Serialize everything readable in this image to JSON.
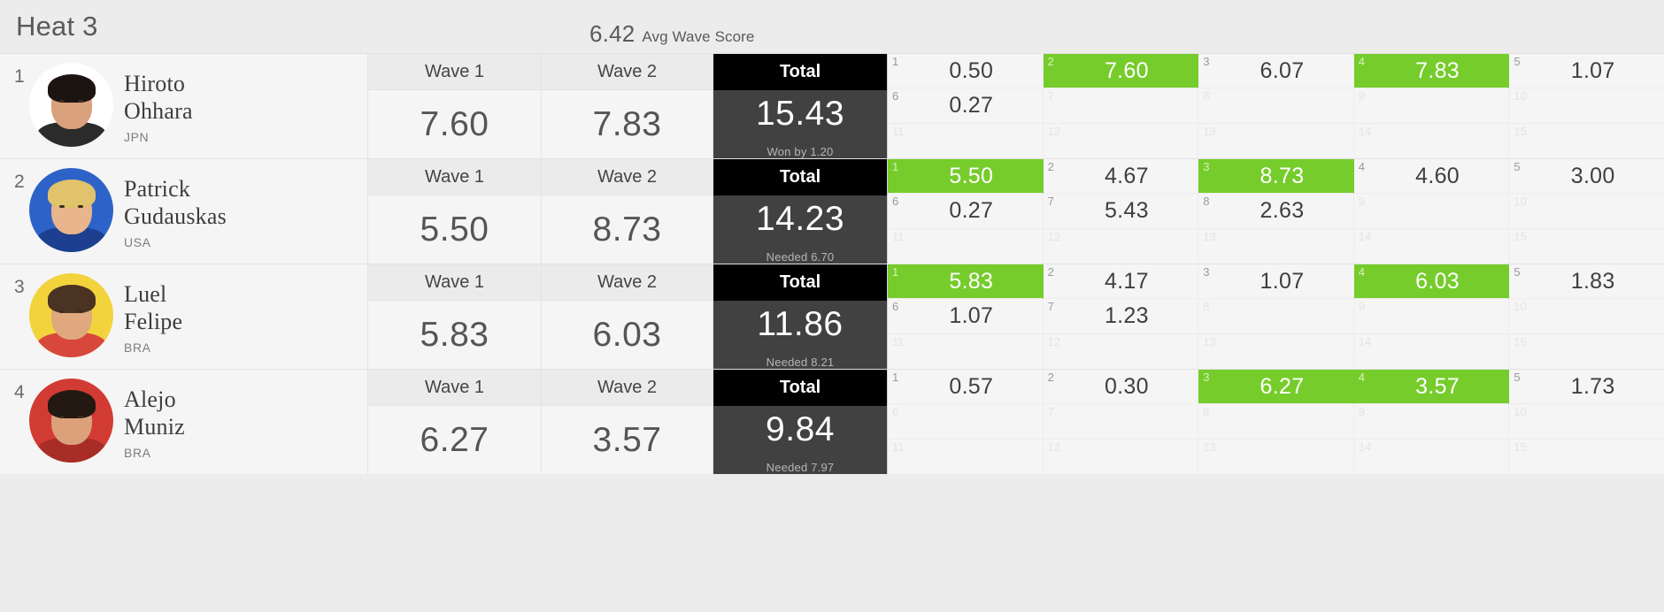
{
  "header": {
    "heat_title": "Heat 3",
    "avg_value": "6.42",
    "avg_label": "Avg Wave Score"
  },
  "columns": {
    "wave1": "Wave 1",
    "wave2": "Wave 2",
    "total": "Total"
  },
  "colors": {
    "highlight_green": "#76cc2b",
    "total_header_bg": "#000000",
    "total_body_bg": "#414141",
    "page_bg": "#ececec",
    "row_bg": "#f5f5f5"
  },
  "surfers": [
    {
      "rank": "1",
      "first_name": "Hiroto",
      "last_name": "Ohhara",
      "country": "JPN",
      "wave1": "7.60",
      "wave2": "7.83",
      "total": "15.43",
      "note": "Won by 1.20",
      "avatar": {
        "bg": "#ffffff",
        "skin": "#d9a07c",
        "hair": "#1c1411",
        "shirt": "#2b2b2b"
      },
      "waves": [
        {
          "idx": "1",
          "value": "0.50",
          "counting": false
        },
        {
          "idx": "2",
          "value": "7.60",
          "counting": true
        },
        {
          "idx": "3",
          "value": "6.07",
          "counting": false
        },
        {
          "idx": "4",
          "value": "7.83",
          "counting": true
        },
        {
          "idx": "5",
          "value": "1.07",
          "counting": false
        },
        {
          "idx": "6",
          "value": "0.27",
          "counting": false
        },
        {
          "idx": "7",
          "value": "",
          "counting": false
        },
        {
          "idx": "8",
          "value": "",
          "counting": false
        },
        {
          "idx": "9",
          "value": "",
          "counting": false
        },
        {
          "idx": "10",
          "value": "",
          "counting": false
        },
        {
          "idx": "11",
          "value": "",
          "counting": false
        },
        {
          "idx": "12",
          "value": "",
          "counting": false
        },
        {
          "idx": "13",
          "value": "",
          "counting": false
        },
        {
          "idx": "14",
          "value": "",
          "counting": false
        },
        {
          "idx": "15",
          "value": "",
          "counting": false
        }
      ]
    },
    {
      "rank": "2",
      "first_name": "Patrick",
      "last_name": "Gudauskas",
      "country": "USA",
      "wave1": "5.50",
      "wave2": "8.73",
      "total": "14.23",
      "note": "Needed 6.70",
      "avatar": {
        "bg": "#2d63c8",
        "skin": "#e8b58c",
        "hair": "#e0c36a",
        "shirt": "#1c3f8f"
      },
      "waves": [
        {
          "idx": "1",
          "value": "5.50",
          "counting": true
        },
        {
          "idx": "2",
          "value": "4.67",
          "counting": false
        },
        {
          "idx": "3",
          "value": "8.73",
          "counting": true
        },
        {
          "idx": "4",
          "value": "4.60",
          "counting": false
        },
        {
          "idx": "5",
          "value": "3.00",
          "counting": false
        },
        {
          "idx": "6",
          "value": "0.27",
          "counting": false
        },
        {
          "idx": "7",
          "value": "5.43",
          "counting": false
        },
        {
          "idx": "8",
          "value": "2.63",
          "counting": false
        },
        {
          "idx": "9",
          "value": "",
          "counting": false
        },
        {
          "idx": "10",
          "value": "",
          "counting": false
        },
        {
          "idx": "11",
          "value": "",
          "counting": false
        },
        {
          "idx": "12",
          "value": "",
          "counting": false
        },
        {
          "idx": "13",
          "value": "",
          "counting": false
        },
        {
          "idx": "14",
          "value": "",
          "counting": false
        },
        {
          "idx": "15",
          "value": "",
          "counting": false
        }
      ]
    },
    {
      "rank": "3",
      "first_name": "Luel",
      "last_name": "Felipe",
      "country": "BRA",
      "wave1": "5.83",
      "wave2": "6.03",
      "total": "11.86",
      "note": "Needed 8.21",
      "avatar": {
        "bg": "#f2d33c",
        "skin": "#e0a87e",
        "hair": "#4a3322",
        "shirt": "#d8473c"
      },
      "waves": [
        {
          "idx": "1",
          "value": "5.83",
          "counting": true
        },
        {
          "idx": "2",
          "value": "4.17",
          "counting": false
        },
        {
          "idx": "3",
          "value": "1.07",
          "counting": false
        },
        {
          "idx": "4",
          "value": "6.03",
          "counting": true
        },
        {
          "idx": "5",
          "value": "1.83",
          "counting": false
        },
        {
          "idx": "6",
          "value": "1.07",
          "counting": false
        },
        {
          "idx": "7",
          "value": "1.23",
          "counting": false
        },
        {
          "idx": "8",
          "value": "",
          "counting": false
        },
        {
          "idx": "9",
          "value": "",
          "counting": false
        },
        {
          "idx": "10",
          "value": "",
          "counting": false
        },
        {
          "idx": "11",
          "value": "",
          "counting": false
        },
        {
          "idx": "12",
          "value": "",
          "counting": false
        },
        {
          "idx": "13",
          "value": "",
          "counting": false
        },
        {
          "idx": "14",
          "value": "",
          "counting": false
        },
        {
          "idx": "15",
          "value": "",
          "counting": false
        }
      ]
    },
    {
      "rank": "4",
      "first_name": "Alejo",
      "last_name": "Muniz",
      "country": "BRA",
      "wave1": "6.27",
      "wave2": "3.57",
      "total": "9.84",
      "note": "Needed 7.97",
      "avatar": {
        "bg": "#d23b33",
        "skin": "#dca17a",
        "hair": "#241812",
        "shirt": "#a82d27"
      },
      "waves": [
        {
          "idx": "1",
          "value": "0.57",
          "counting": false
        },
        {
          "idx": "2",
          "value": "0.30",
          "counting": false
        },
        {
          "idx": "3",
          "value": "6.27",
          "counting": true
        },
        {
          "idx": "4",
          "value": "3.57",
          "counting": true
        },
        {
          "idx": "5",
          "value": "1.73",
          "counting": false
        },
        {
          "idx": "6",
          "value": "",
          "counting": false
        },
        {
          "idx": "7",
          "value": "",
          "counting": false
        },
        {
          "idx": "8",
          "value": "",
          "counting": false
        },
        {
          "idx": "9",
          "value": "",
          "counting": false
        },
        {
          "idx": "10",
          "value": "",
          "counting": false
        },
        {
          "idx": "11",
          "value": "",
          "counting": false
        },
        {
          "idx": "12",
          "value": "",
          "counting": false
        },
        {
          "idx": "13",
          "value": "",
          "counting": false
        },
        {
          "idx": "14",
          "value": "",
          "counting": false
        },
        {
          "idx": "15",
          "value": "",
          "counting": false
        }
      ]
    }
  ]
}
